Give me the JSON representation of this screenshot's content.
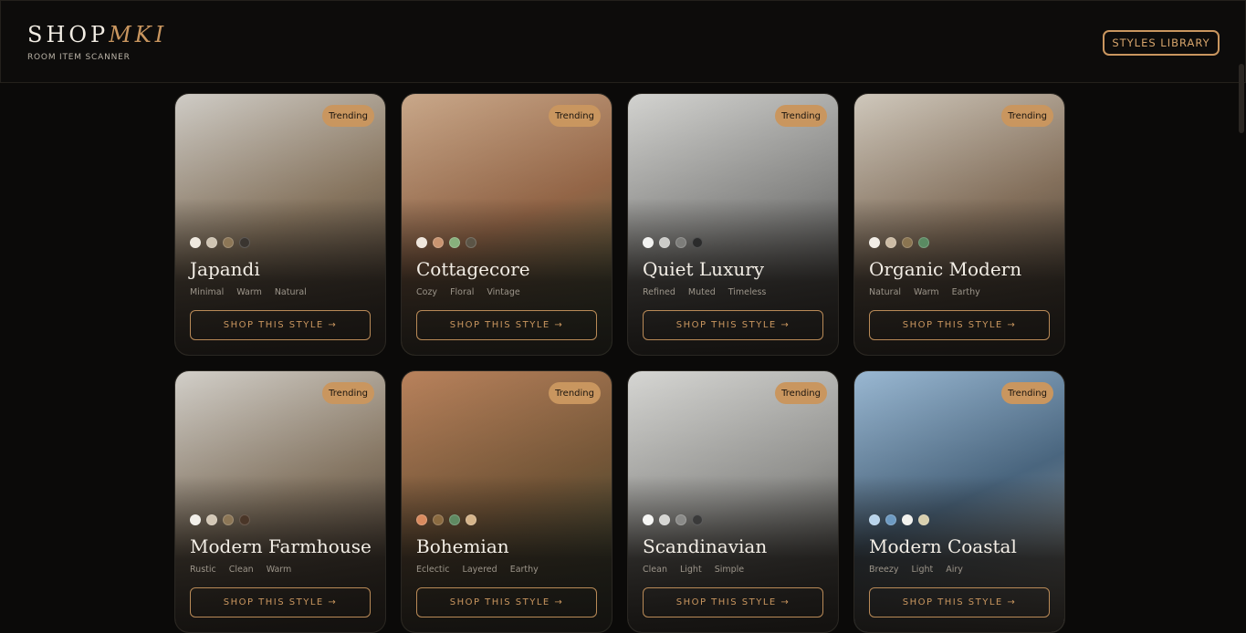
{
  "header": {
    "brand_main": "SHOP",
    "brand_accent": "MKI",
    "subtitle": "ROOM ITEM SCANNER",
    "library_button": "STYLES LIBRARY"
  },
  "cards": [
    {
      "title": "Japandi",
      "badge": "Trending",
      "tags": [
        "Minimal",
        "Warm",
        "Natural"
      ],
      "button": "SHOP THIS STYLE →",
      "swatches": [
        "#efe9df",
        "#cfc4b2",
        "#8c7656",
        "#3a3530"
      ],
      "gradient": [
        "#cfccc6",
        "#8d7a63",
        "#3e3228"
      ]
    },
    {
      "title": "Cottagecore",
      "badge": "Trending",
      "tags": [
        "Cozy",
        "Floral",
        "Vintage"
      ],
      "button": "SHOP THIS STYLE →",
      "swatches": [
        "#efe6dc",
        "#c99470",
        "#87b07c",
        "#5b5446"
      ],
      "gradient": [
        "#c9a88a",
        "#9a6a4a",
        "#3f5a3a"
      ]
    },
    {
      "title": "Quiet Luxury",
      "badge": "Trending",
      "tags": [
        "Refined",
        "Muted",
        "Timeless"
      ],
      "button": "SHOP THIS STYLE →",
      "swatches": [
        "#f2f2f0",
        "#cbcbc8",
        "#7d7d7a",
        "#2b2b2b"
      ],
      "gradient": [
        "#d3d3d0",
        "#8e8e8c",
        "#3a3a3a"
      ]
    },
    {
      "title": "Organic Modern",
      "badge": "Trending",
      "tags": [
        "Natural",
        "Warm",
        "Earthy"
      ],
      "button": "SHOP THIS STYLE →",
      "swatches": [
        "#f2ede6",
        "#cdbca5",
        "#8a7450",
        "#5a8a62"
      ],
      "gradient": [
        "#cfc8bc",
        "#8a7560",
        "#3c3329"
      ]
    },
    {
      "title": "Modern Farmhouse",
      "badge": "Trending",
      "tags": [
        "Rustic",
        "Clean",
        "Warm"
      ],
      "button": "SHOP THIS STYLE →",
      "swatches": [
        "#f2efe9",
        "#d3c7b5",
        "#8c7656",
        "#4a3628"
      ],
      "gradient": [
        "#d2cfc9",
        "#8c7c68",
        "#3e3128"
      ]
    },
    {
      "title": "Bohemian",
      "badge": "Trending",
      "tags": [
        "Eclectic",
        "Layered",
        "Earthy"
      ],
      "button": "SHOP THIS STYLE →",
      "swatches": [
        "#d98a5e",
        "#8a6a40",
        "#5f8a62",
        "#d5b48a"
      ],
      "gradient": [
        "#b9825c",
        "#7a5a3a",
        "#2f4631"
      ]
    },
    {
      "title": "Scandinavian",
      "badge": "Trending",
      "tags": [
        "Clean",
        "Light",
        "Simple"
      ],
      "button": "SHOP THIS STYLE →",
      "swatches": [
        "#f6f6f4",
        "#d6d6d3",
        "#8a8a88",
        "#3a3a3a"
      ],
      "gradient": [
        "#d6d6d3",
        "#9a9a97",
        "#3f3f3d"
      ]
    },
    {
      "title": "Modern Coastal",
      "badge": "Trending",
      "tags": [
        "Breezy",
        "Light",
        "Airy"
      ],
      "button": "SHOP THIS STYLE →",
      "swatches": [
        "#b8d3ea",
        "#6d9ac2",
        "#f2f2ee",
        "#d8cfae"
      ],
      "gradient": [
        "#9ab8d2",
        "#4d6a84",
        "#b5aea2"
      ]
    }
  ]
}
